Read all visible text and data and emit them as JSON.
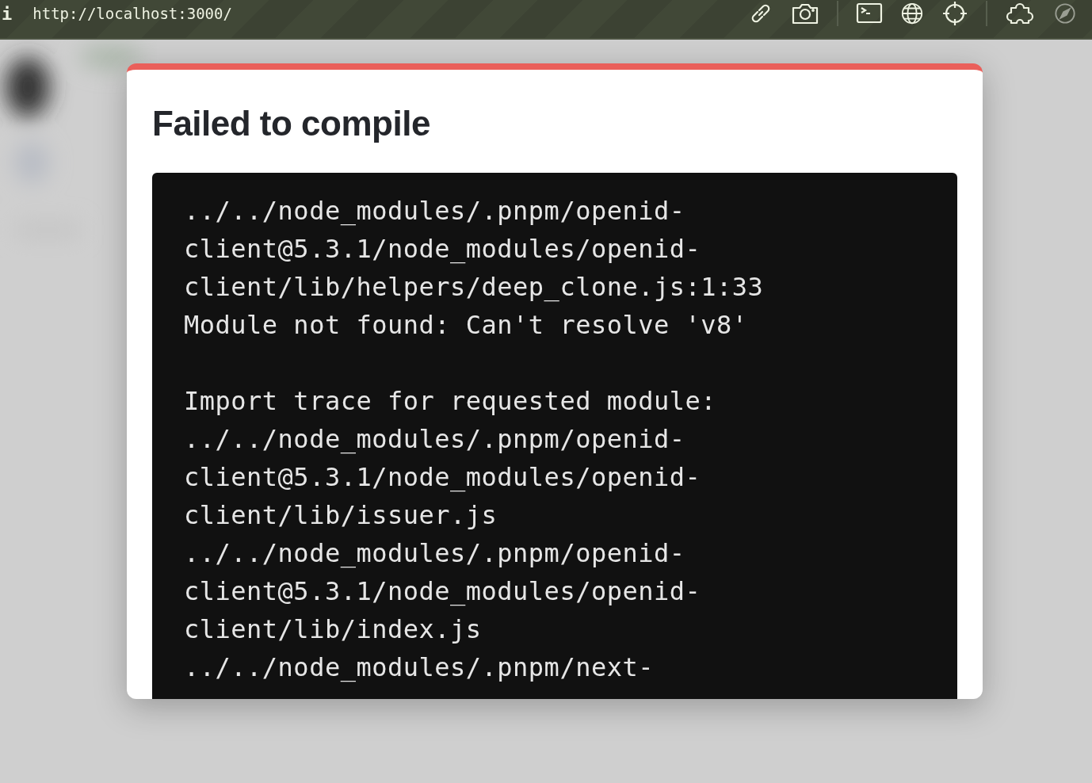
{
  "address_bar": {
    "info_glyph": "i",
    "url": "http://localhost:3000/"
  },
  "toolbar": [
    [
      {
        "kind": "link",
        "disabled": false
      },
      {
        "kind": "camera",
        "disabled": false
      }
    ],
    [
      {
        "kind": "terminal",
        "disabled": false
      },
      {
        "kind": "globe",
        "disabled": false
      },
      {
        "kind": "crosshair",
        "disabled": false
      }
    ],
    [
      {
        "kind": "puzzle",
        "disabled": false
      },
      {
        "kind": "compass",
        "disabled": true
      }
    ]
  ],
  "background": {
    "kind": "picture"
  },
  "error_dialog": {
    "title": "Failed to compile",
    "code_blocks": [
      [
        "../../node_modules/.pnpm/openid-",
        "client@5.3.1/node_modules/openid-",
        "client/lib/helpers/deep_clone.js:1:33",
        "Module not found: Can't resolve 'v8'"
      ],
      [
        "Import trace for requested module:",
        "../../node_modules/.pnpm/openid-",
        "client@5.3.1/node_modules/openid-",
        "client/lib/issuer.js",
        "../../node_modules/.pnpm/openid-",
        "client@5.3.1/node_modules/openid-",
        "client/lib/index.js",
        "../../node_modules/.pnpm/next-"
      ]
    ]
  }
}
